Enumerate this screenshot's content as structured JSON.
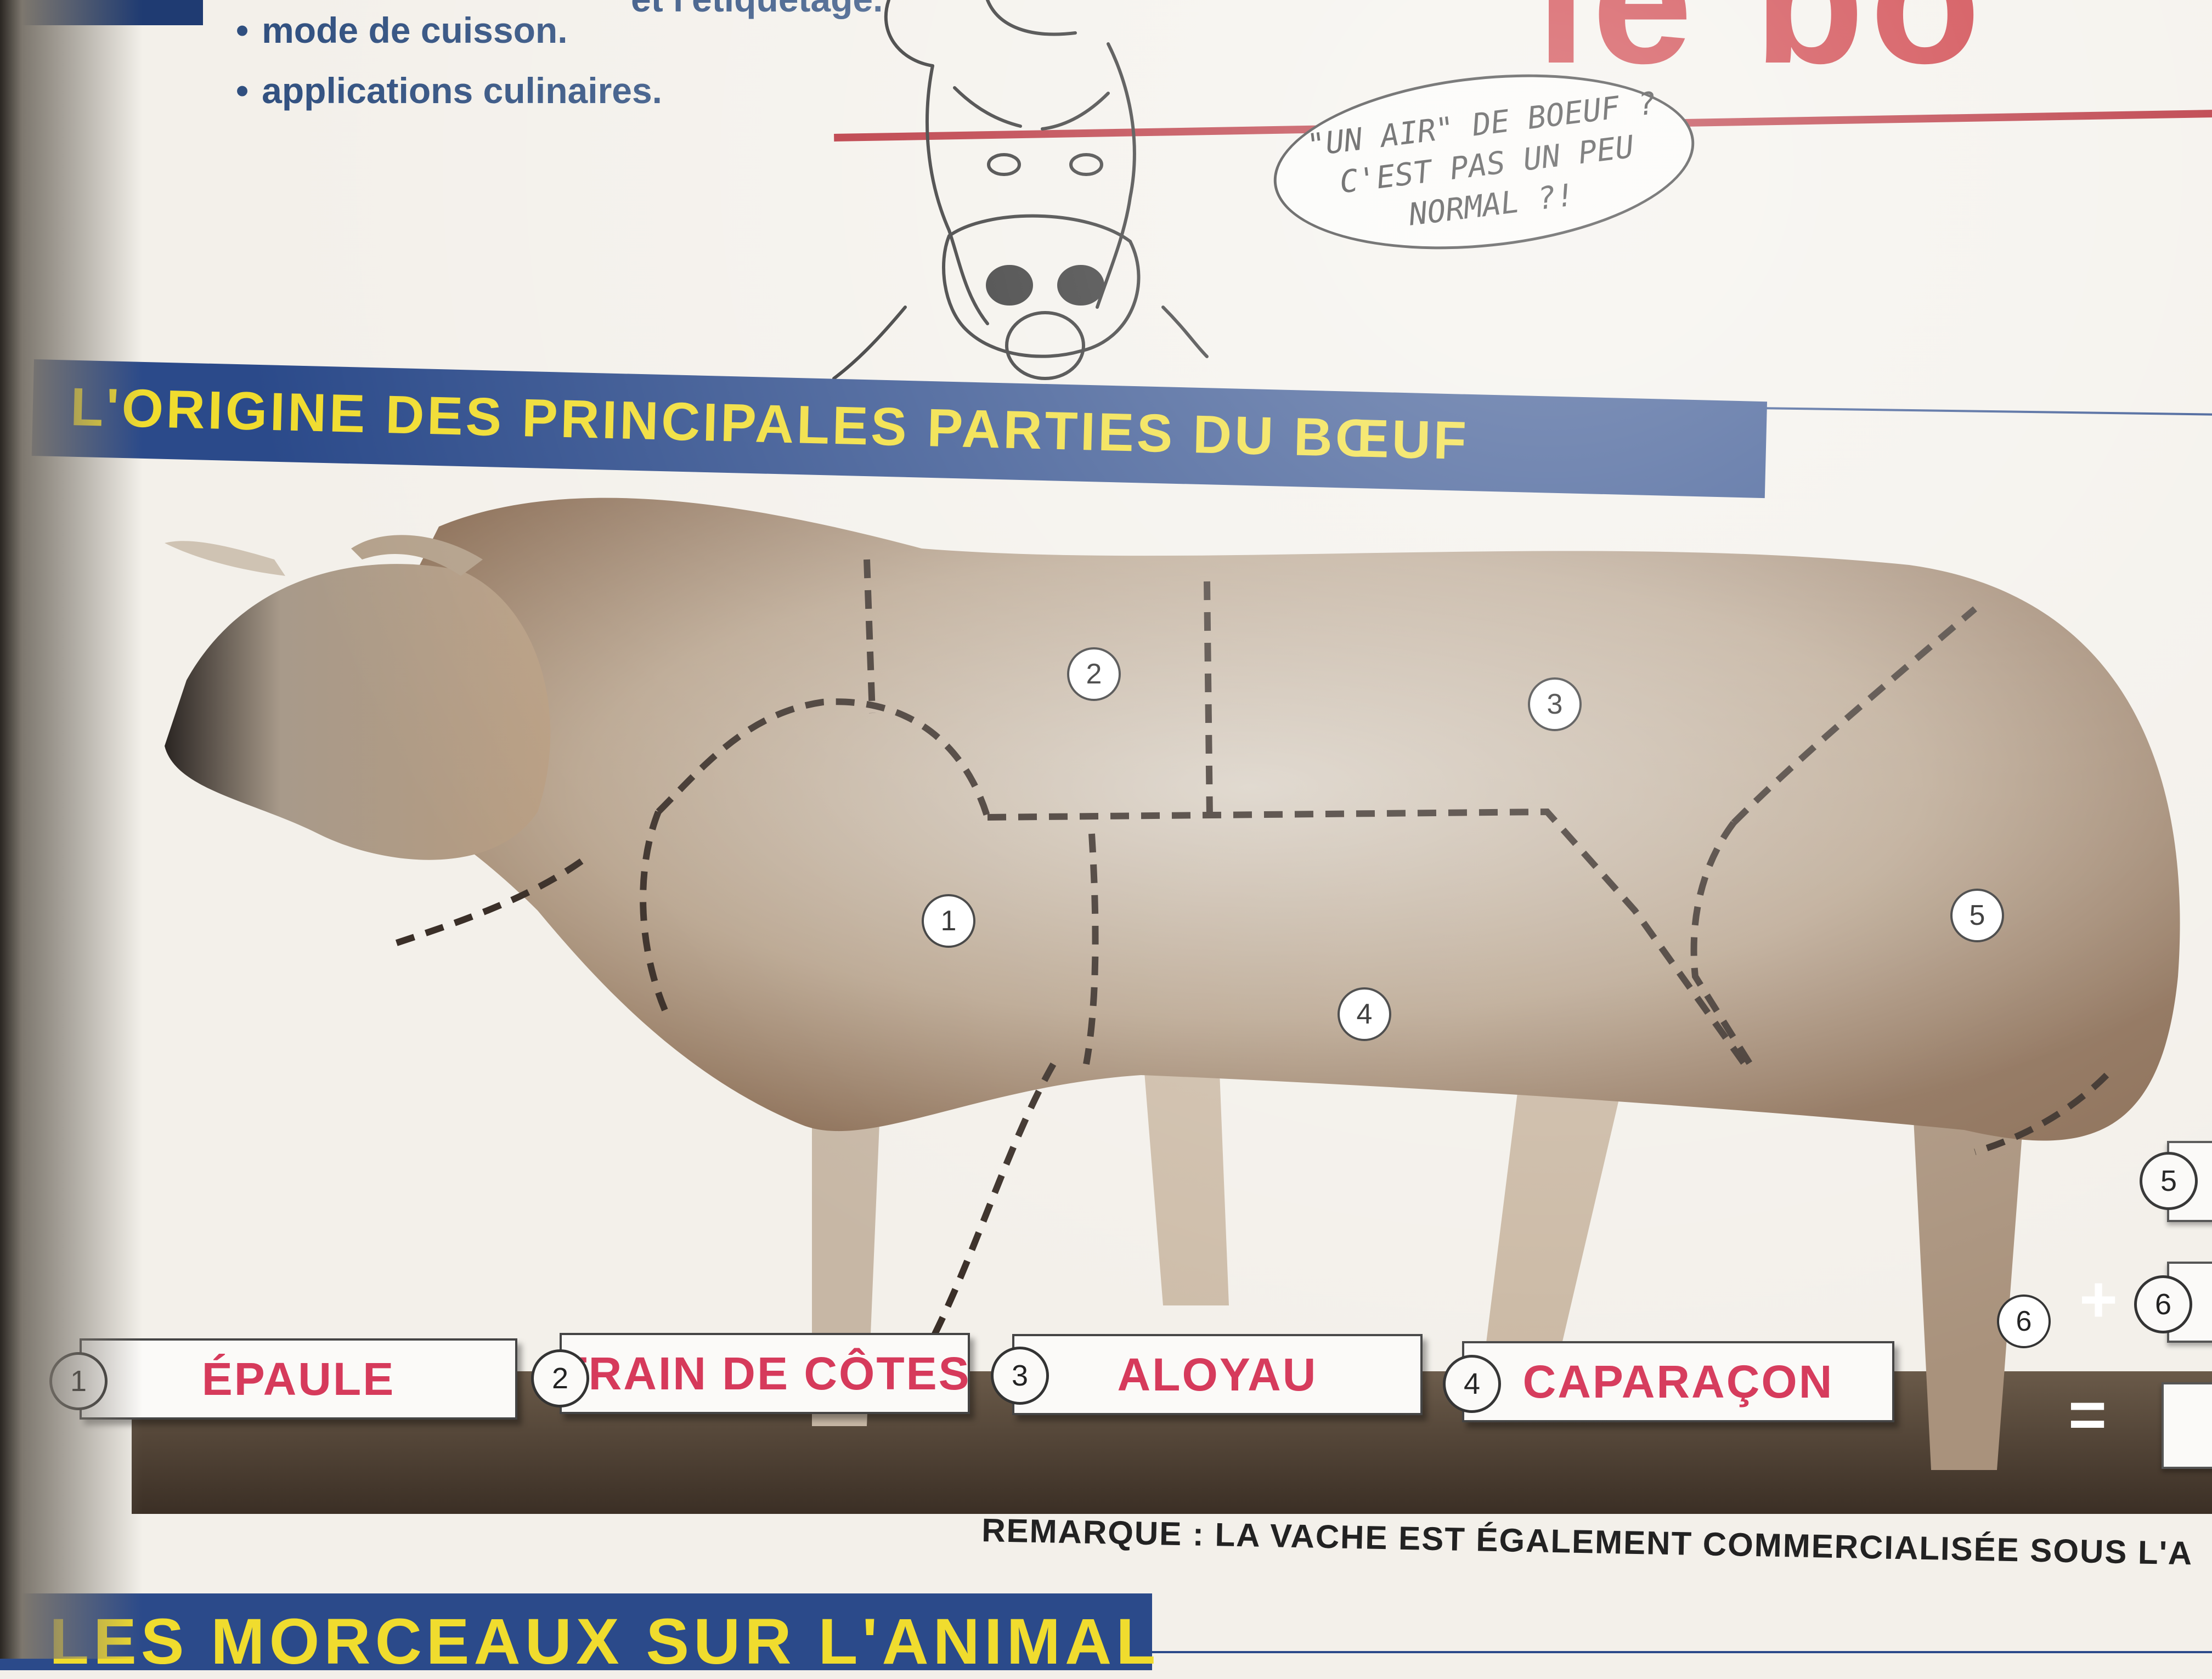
{
  "header": {
    "partial_text": "et l'étiquetage.",
    "bullets": [
      "mode de cuisson.",
      "applications culinaires."
    ],
    "big_title_partial": "le bo"
  },
  "cartoon": {
    "speech_bubble": [
      "\"UN AIR\" DE BOEUF ?",
      "C'EST PAS UN PEU",
      "NORMAL ?!"
    ]
  },
  "section": {
    "title": "L'ORIGINE DES PRINCIPALES PARTIES DU BŒUF"
  },
  "diagram_numbers": [
    "1",
    "2",
    "3",
    "4",
    "5"
  ],
  "parts": [
    {
      "num": "1",
      "label": "ÉPAULE"
    },
    {
      "num": "2",
      "label": "TRAIN DE CÔTES"
    },
    {
      "num": "3",
      "label": "ALOYAU"
    },
    {
      "num": "4",
      "label": "CAPARAÇON"
    }
  ],
  "side_numbers": [
    "5",
    "6",
    "6"
  ],
  "side_symbols": {
    "plus": "+",
    "equals": "="
  },
  "remark": "REMARQUE : LA VACHE EST ÉGALEMENT COMMERCIALISÉE SOUS L'A",
  "next_section": {
    "title": "LES MORCEAUX SUR L'ANIMAL"
  },
  "colors": {
    "heading_bg": "#2b4a8a",
    "heading_text": "#f0dc2e",
    "label_text": "#d63a5b",
    "title_red": "#c8272e"
  }
}
